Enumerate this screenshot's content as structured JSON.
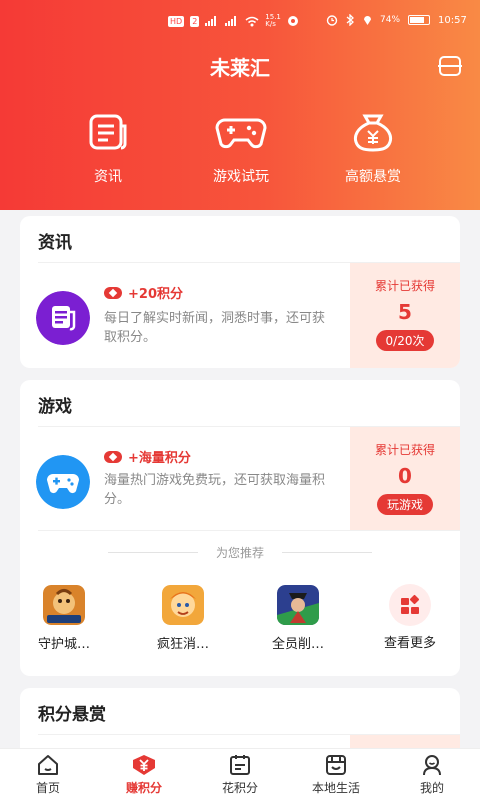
{
  "status_bar": {
    "left_chips": [
      "HD",
      "2"
    ],
    "speed": "15.1\nK/s",
    "battery": "74%",
    "time": "10:57"
  },
  "header": {
    "title": "未莱汇"
  },
  "categories": [
    {
      "label": "资讯",
      "icon": "news-icon"
    },
    {
      "label": "游戏试玩",
      "icon": "gamepad-icon"
    },
    {
      "label": "高额悬赏",
      "icon": "money-bag-icon"
    }
  ],
  "sections": {
    "news": {
      "title": "资讯",
      "reward": "+20积分",
      "desc": "每日了解实时新闻，洞悉时事，还可获取积分。",
      "earn_label": "累计已获得",
      "earn_value": "5",
      "earn_button": "0/20次"
    },
    "games": {
      "title": "游戏",
      "reward": "+海量积分",
      "desc": "海量热门游戏免费玩，还可获取海量积分。",
      "earn_label": "累计已获得",
      "earn_value": "0",
      "earn_button": "玩游戏",
      "recommend_label": "为您推荐",
      "list": [
        {
          "name": "守护城…"
        },
        {
          "name": "疯狂消…"
        },
        {
          "name": "全员削…"
        }
      ],
      "more_label": "查看更多"
    },
    "bounty": {
      "title": "积分悬赏"
    }
  },
  "tabs": [
    {
      "label": "首页",
      "icon": "home-icon"
    },
    {
      "label": "赚积分",
      "icon": "yen-icon",
      "active": true
    },
    {
      "label": "花积分",
      "icon": "calendar-icon"
    },
    {
      "label": "本地生活",
      "icon": "store-icon"
    },
    {
      "label": "我的",
      "icon": "profile-icon"
    }
  ],
  "colors": {
    "accent": "#e53935",
    "header_start": "#f53a36",
    "header_end": "#f98a45",
    "earn_bg": "#ffeae3"
  }
}
